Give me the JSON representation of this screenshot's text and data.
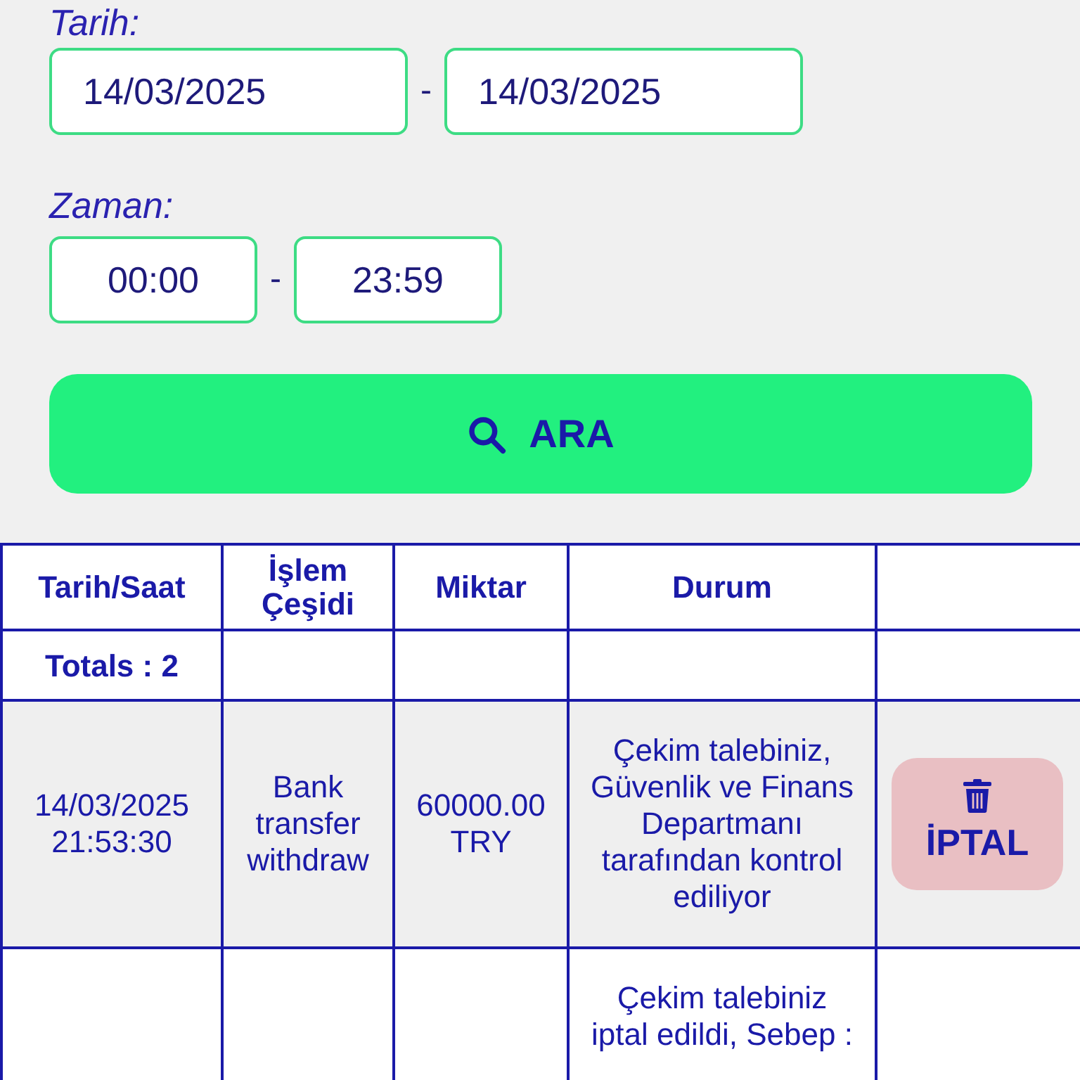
{
  "filters": {
    "date_label": "Tarih:",
    "date_from": "14/03/2025",
    "date_separator": "-",
    "date_to": "14/03/2025",
    "time_label": "Zaman:",
    "time_from": "00:00",
    "time_separator": "-",
    "time_to": "23:59"
  },
  "search_button": "ARA",
  "table": {
    "columns": [
      "Tarih/Saat",
      "İşlem Çeşidi",
      "Miktar",
      "Durum"
    ],
    "totals": "Totals : 2",
    "rows": [
      {
        "datetime": "14/03/2025 21:53:30",
        "type": "Bank transfer withdraw",
        "amount": "60000.00 TRY",
        "status": "Çekim talebiniz, Güvenlik ve Finans Departmanı tarafından kontrol ediliyor",
        "action": "İPTAL"
      },
      {
        "status": "Çekim talebiniz iptal edildi, Sebep :"
      }
    ]
  }
}
